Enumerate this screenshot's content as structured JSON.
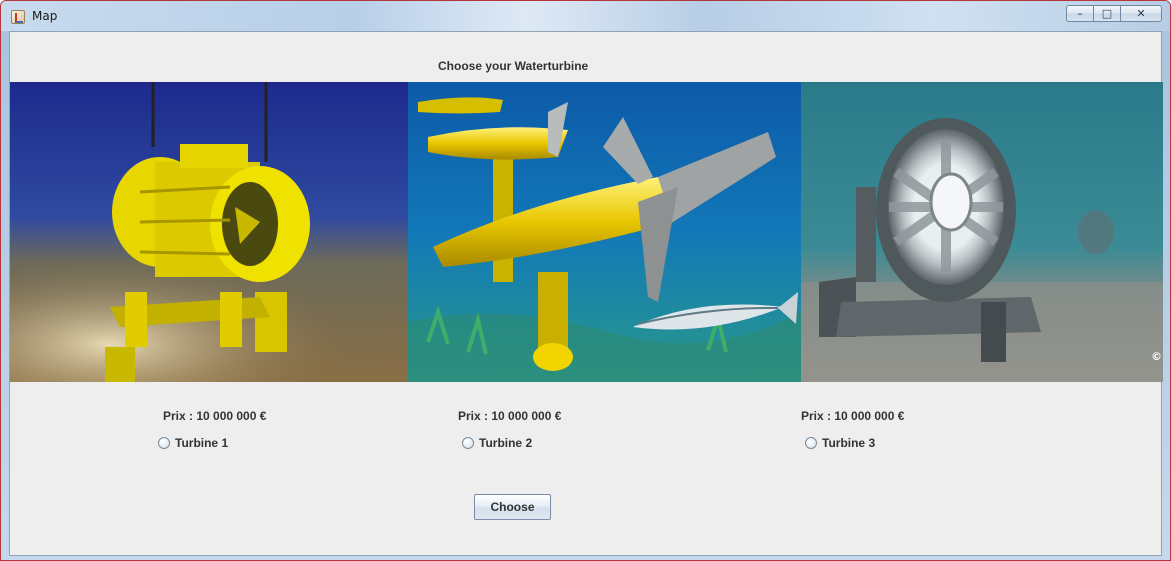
{
  "window": {
    "title": "Map",
    "minimize_glyph": "–",
    "maximize_glyph": "□",
    "close_glyph": "✕"
  },
  "main": {
    "heading": "Choose your Waterturbine",
    "turbines": [
      {
        "price": "Prix : 10 000 000 €",
        "label": "Turbine 1",
        "image": "underwater-turbine-1-image"
      },
      {
        "price": "Prix : 10 000 000 €",
        "label": "Turbine 2",
        "image": "underwater-turbine-2-image"
      },
      {
        "price": "Prix : 10 000 000 €",
        "label": "Turbine 3",
        "image": "underwater-turbine-3-image"
      }
    ],
    "choose_label": "Choose",
    "image_watermark": "© E"
  },
  "colors": {
    "window_border": "#b8343a",
    "client_background": "#eeeeee",
    "turbine_yellow": "#e6d400"
  }
}
